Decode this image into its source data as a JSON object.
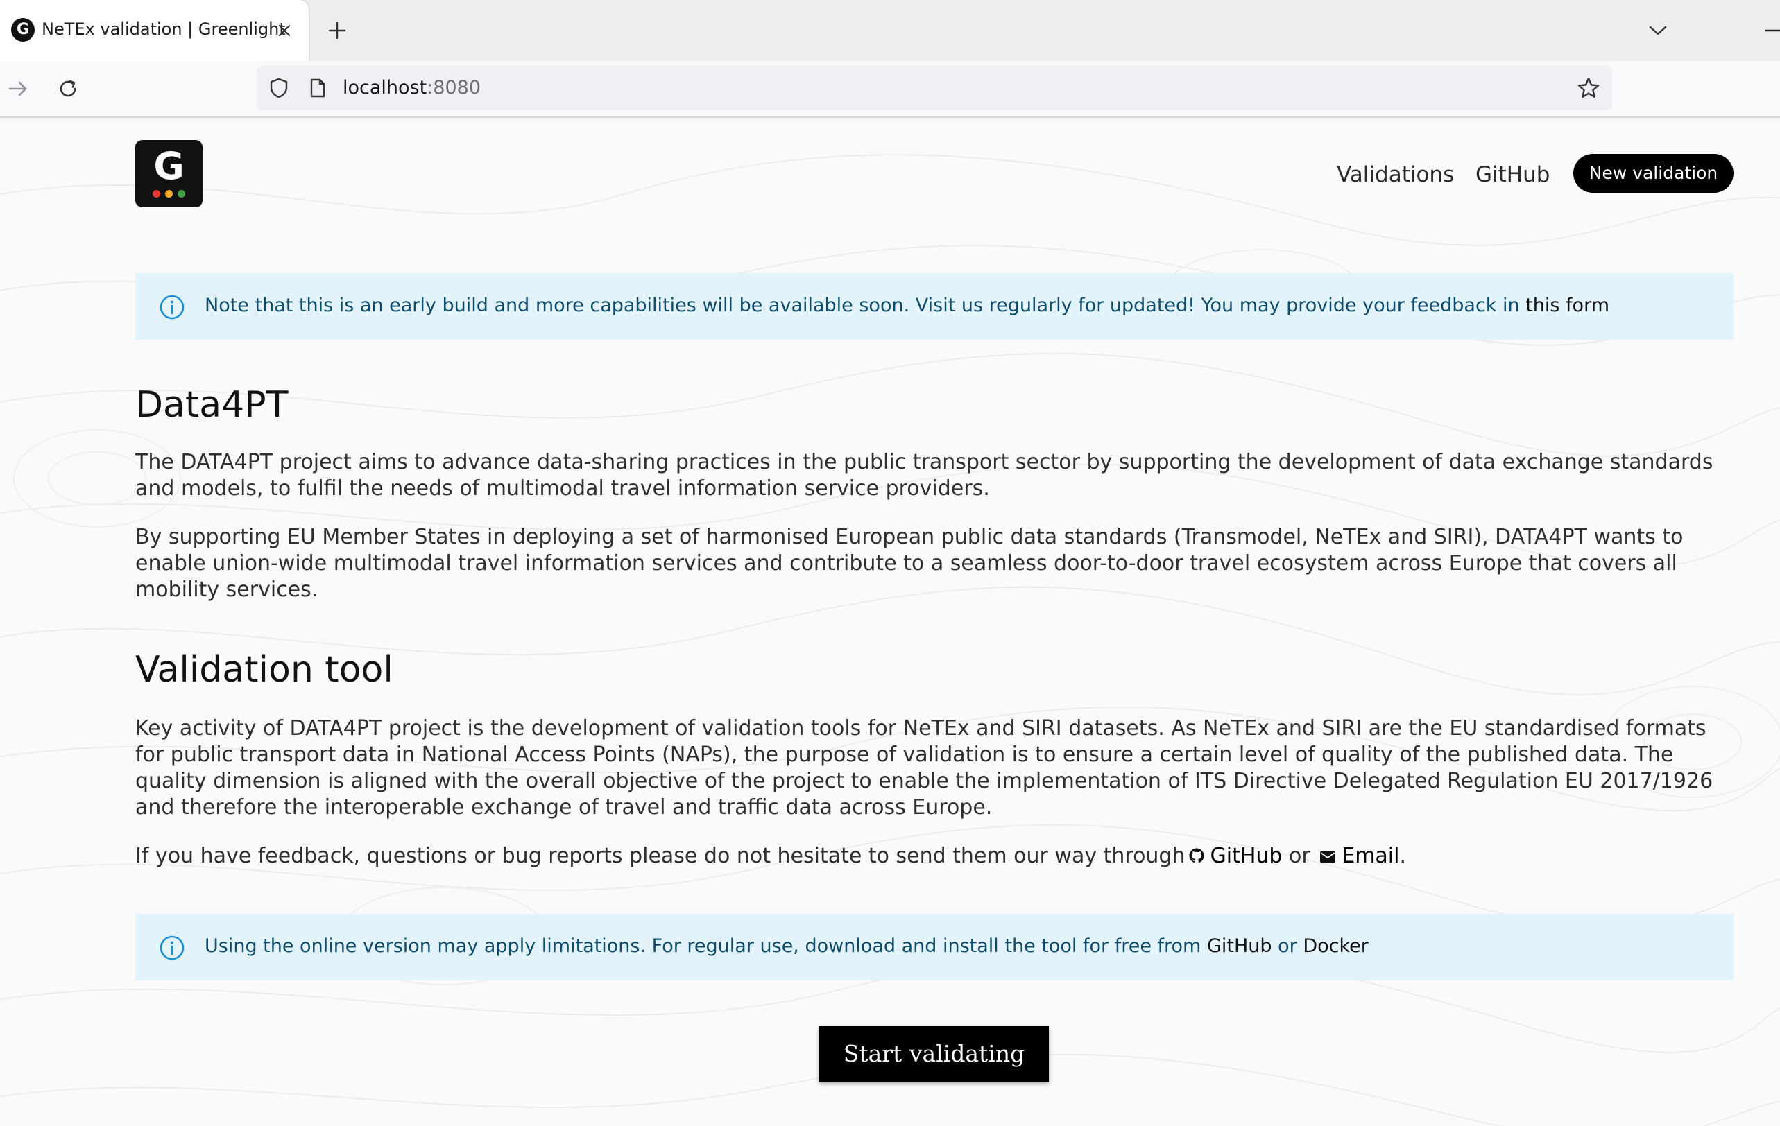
{
  "browser": {
    "tab_title": "NeTEx validation | Greenlight",
    "tab_favicon_letter": "G",
    "url_host": "localhost",
    "url_port": ":8080"
  },
  "header": {
    "logo_letter": "G",
    "nav_validations": "Validations",
    "nav_github": "GitHub",
    "new_validation_label": "New validation"
  },
  "notice_top": {
    "text": "Note that this is an early build and more capabilities will be available soon. Visit us regularly for updated! You may provide your feedback in ",
    "link": "this form"
  },
  "data4pt": {
    "heading": "Data4PT",
    "p1_line1": "The DATA4PT project aims to advance data-sharing practices in the public transport sector by supporting the development of data exchange standards",
    "p1_line2": "and models, to fulfil the needs of multimodal travel information service providers.",
    "p2_line1": "By supporting EU Member States in deploying a set of harmonised European public data standards (Transmodel, NeTEx and SIRI), DATA4PT wants to",
    "p2_line2": "enable union-wide multimodal travel information services and contribute to a seamless door-to-door travel ecosystem across Europe that covers all",
    "p2_line3": "mobility services."
  },
  "validation_tool": {
    "heading": "Validation tool",
    "p1_line1": "Key activity of DATA4PT project is the development of validation tools for NeTEx and SIRI datasets. As NeTEx and SIRI are the EU standardised formats",
    "p1_line2": "for public transport data in National Access Points (NAPs), the purpose of validation is to ensure a certain level of quality of the published data. The",
    "p1_line3": "quality dimension is aligned with the overall objective of the project to enable the implementation of ITS Directive Delegated Regulation EU 2017/1926",
    "p1_line4": "and therefore the interoperable exchange of travel and traffic data across Europe.",
    "feedback_prefix": "If you have feedback, questions or bug reports please do not hesitate to send them our way through",
    "feedback_github": "GitHub",
    "feedback_or": " or ",
    "feedback_email": "Email",
    "feedback_end": "."
  },
  "notice_bottom": {
    "text": "Using the online version may apply limitations. For regular use, download and install the tool for free from ",
    "link_github": "GitHub",
    "or": " or ",
    "link_docker": "Docker"
  },
  "cta": {
    "start_label": "Start validating"
  },
  "icons": {
    "favicon": "greenlight-logo-icon",
    "tab_close": "close-icon",
    "new_tab": "plus-icon",
    "tab_list": "chevron-down-icon",
    "forward": "arrow-right-icon",
    "reload": "reload-icon",
    "shield": "shield-icon",
    "page": "page-icon",
    "bookmark": "star-icon",
    "info": "info-icon",
    "github": "github-icon",
    "email": "mail-icon"
  },
  "colors": {
    "logo_red": "#e53935",
    "logo_yellow": "#f9a825",
    "logo_green": "#43a047",
    "alert_bg": "#e3f3fb",
    "alert_text": "#0f4c6b",
    "info_icon": "#1a8fd1"
  }
}
